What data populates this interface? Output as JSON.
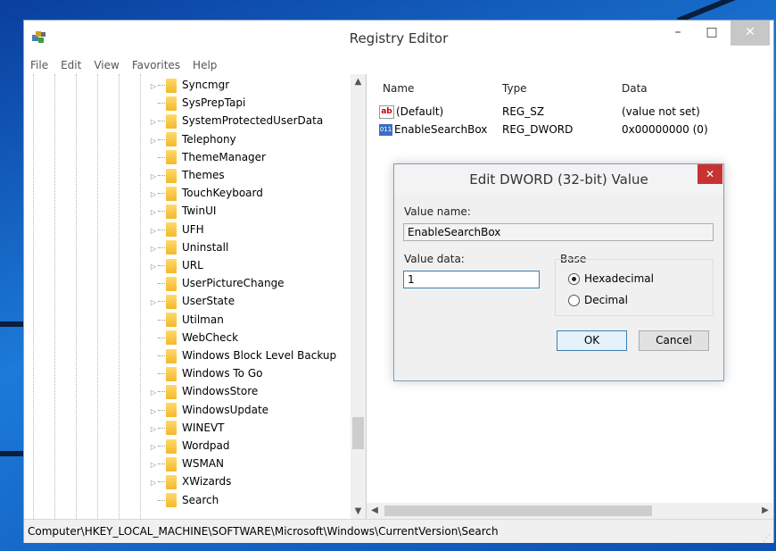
{
  "window": {
    "title": "Registry Editor",
    "minimize": "–",
    "maximize": "□",
    "close": "✕"
  },
  "menu": [
    "File",
    "Edit",
    "View",
    "Favorites",
    "Help"
  ],
  "tree": [
    {
      "label": "Syncmgr",
      "expander": true
    },
    {
      "label": "SysPrepTapi",
      "expander": false
    },
    {
      "label": "SystemProtectedUserData",
      "expander": true
    },
    {
      "label": "Telephony",
      "expander": true
    },
    {
      "label": "ThemeManager",
      "expander": false
    },
    {
      "label": "Themes",
      "expander": true
    },
    {
      "label": "TouchKeyboard",
      "expander": true
    },
    {
      "label": "TwinUI",
      "expander": true
    },
    {
      "label": "UFH",
      "expander": true
    },
    {
      "label": "Uninstall",
      "expander": true
    },
    {
      "label": "URL",
      "expander": true
    },
    {
      "label": "UserPictureChange",
      "expander": false
    },
    {
      "label": "UserState",
      "expander": true
    },
    {
      "label": "Utilman",
      "expander": false
    },
    {
      "label": "WebCheck",
      "expander": false
    },
    {
      "label": "Windows Block Level Backup",
      "expander": false
    },
    {
      "label": "Windows To Go",
      "expander": false
    },
    {
      "label": "WindowsStore",
      "expander": true
    },
    {
      "label": "WindowsUpdate",
      "expander": true
    },
    {
      "label": "WINEVT",
      "expander": true
    },
    {
      "label": "Wordpad",
      "expander": true
    },
    {
      "label": "WSMAN",
      "expander": true
    },
    {
      "label": "XWizards",
      "expander": true
    },
    {
      "label": "Search",
      "expander": false
    }
  ],
  "list": {
    "columns": [
      "Name",
      "Type",
      "Data"
    ],
    "rows": [
      {
        "icon": "string-value-icon",
        "name": "(Default)",
        "type": "REG_SZ",
        "data": "(value not set)"
      },
      {
        "icon": "binary-value-icon",
        "name": "EnableSearchBox",
        "type": "REG_DWORD",
        "data": "0x00000000 (0)"
      }
    ]
  },
  "status": "Computer\\HKEY_LOCAL_MACHINE\\SOFTWARE\\Microsoft\\Windows\\CurrentVersion\\Search",
  "dialog": {
    "title": "Edit DWORD (32-bit) Value",
    "close": "✕",
    "value_name_label": "Value name:",
    "value_name": "EnableSearchBox",
    "value_data_label": "Value data:",
    "value_data": "1",
    "base_label": "Base",
    "hex_label": "Hexadecimal",
    "dec_label": "Decimal",
    "base_selected": "Hexadecimal",
    "ok": "OK",
    "cancel": "Cancel"
  }
}
